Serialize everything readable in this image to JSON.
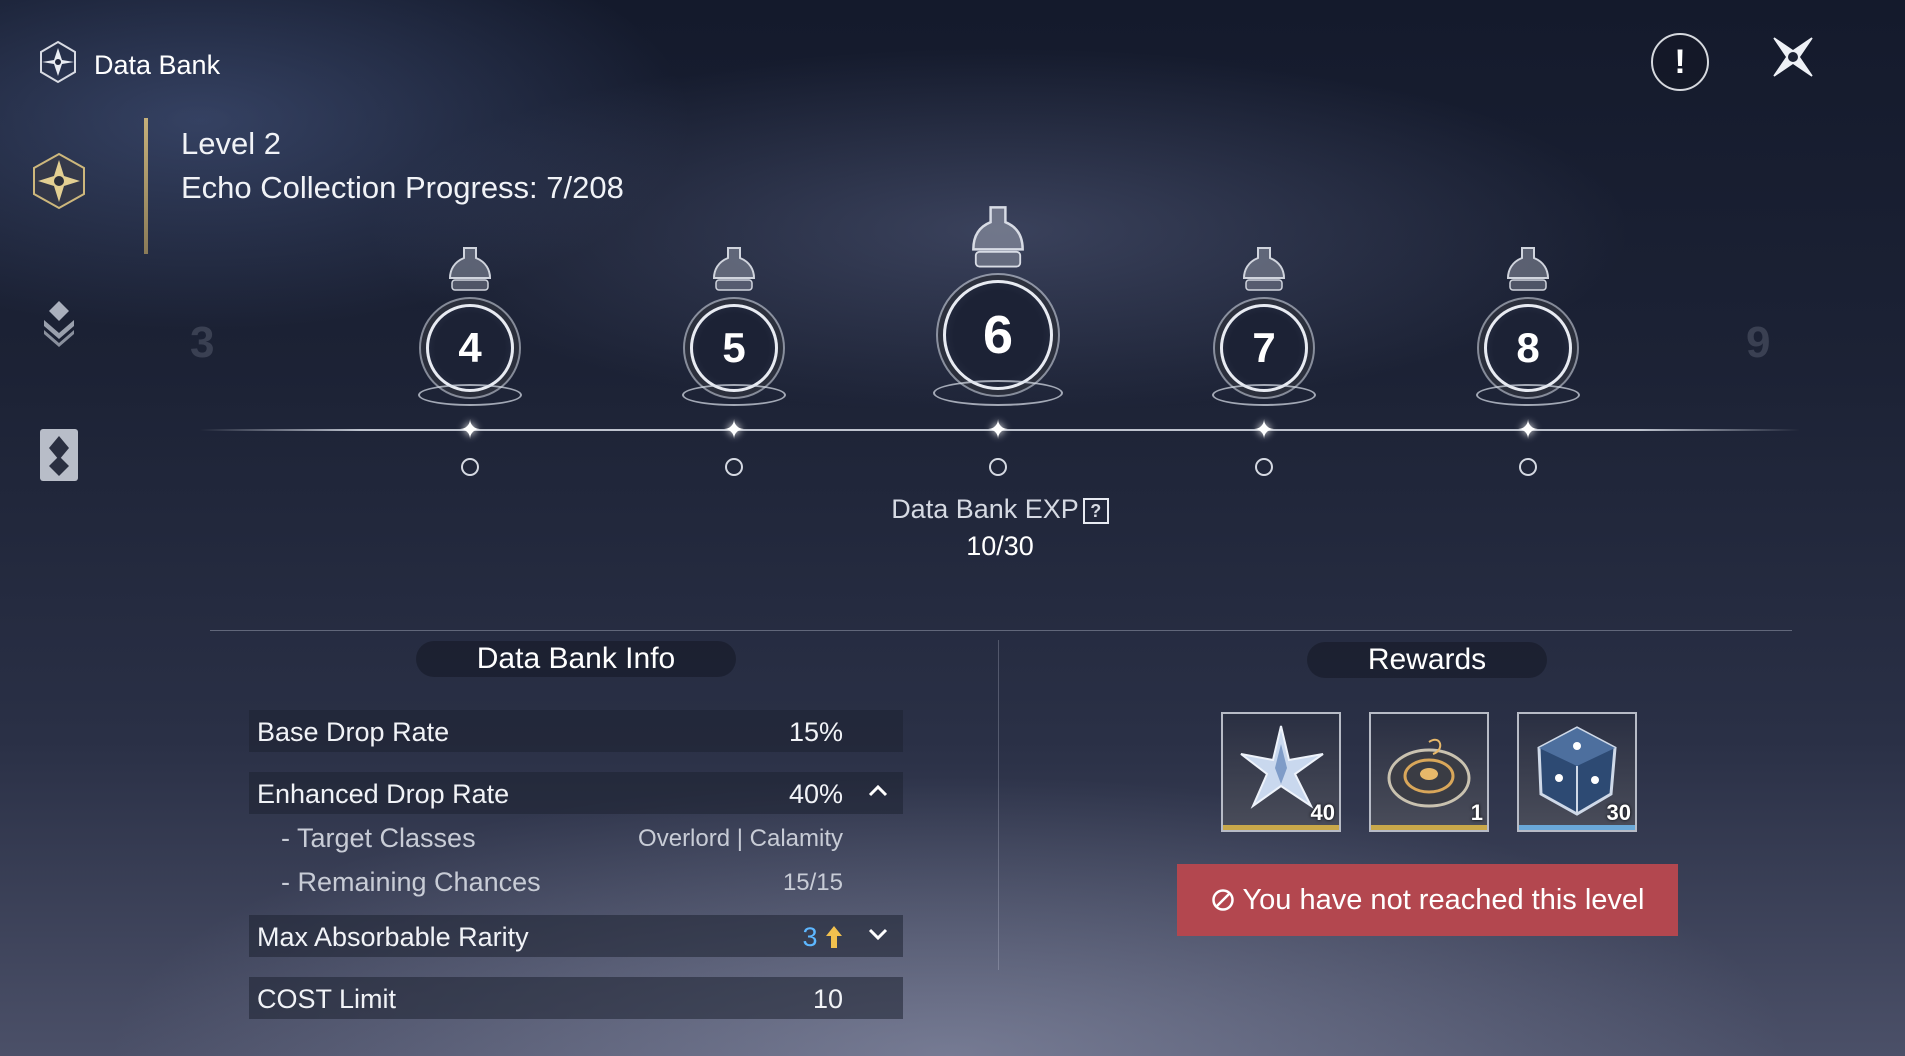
{
  "header": {
    "title": "Data Bank"
  },
  "level": {
    "label": "Level 2",
    "progress_label": "Echo Collection Progress: 7/208"
  },
  "timeline": {
    "nodes": [
      "4",
      "5",
      "6",
      "7",
      "8"
    ],
    "selected": "6",
    "ghost_prev": "3",
    "ghost_next": "9"
  },
  "exp": {
    "label": "Data Bank EXP",
    "help_glyph": "?",
    "value": "10/30"
  },
  "info": {
    "title": "Data Bank Info",
    "rows": [
      {
        "label": "Base Drop Rate",
        "value": "15%"
      },
      {
        "label": "Enhanced Drop Rate",
        "value": "40%"
      },
      {
        "label": "- Target Classes",
        "value": "Overlord | Calamity"
      },
      {
        "label": "- Remaining Chances",
        "value": "15/15"
      },
      {
        "label": "Max Absorbable Rarity",
        "value": "3"
      },
      {
        "label": "COST Limit",
        "value": "10"
      }
    ]
  },
  "rewards": {
    "title": "Rewards",
    "items": [
      {
        "icon": "crystal-star-icon",
        "qty": "40",
        "band": "#c9a84a"
      },
      {
        "icon": "tuner-disc-icon",
        "qty": "1",
        "band": "#c9a84a"
      },
      {
        "icon": "dice-core-icon",
        "qty": "30",
        "band": "#6aa8d8"
      }
    ],
    "warning": "You have not reached this level"
  },
  "icons": {
    "close": "close-x-icon",
    "info": "exclamation-icon",
    "logo": "data-bank-logo-icon",
    "sidebar": [
      "compass-star-icon",
      "layers-icon",
      "card-icon"
    ]
  },
  "colors": {
    "accent_gold": "#c6b07a",
    "warning_red": "#b3474f",
    "rarity_blue": "#5db7ff",
    "rarity_up": "#f2c14e"
  }
}
